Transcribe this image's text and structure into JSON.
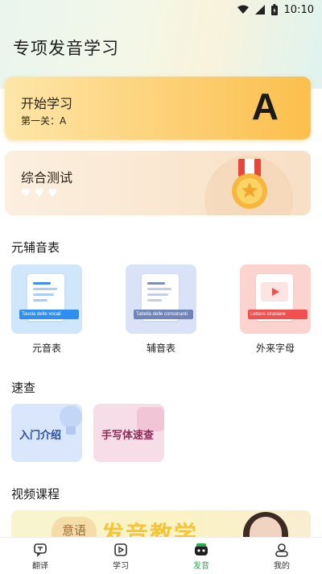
{
  "status": {
    "time": "10:10"
  },
  "header": {
    "title": "专项发音学习"
  },
  "start_card": {
    "title": "开始学习",
    "level": "第一关：A",
    "letter": "A"
  },
  "test_card": {
    "title": "综合测试",
    "hearts": 3
  },
  "sections": {
    "tables": "元辅音表",
    "quick": "速查",
    "video": "视频课程"
  },
  "tables": [
    {
      "label": "元音表",
      "ribbon": "Tavola delle vocali",
      "bg": "#cfe6fb",
      "ribbon_color": "#2f8ff0"
    },
    {
      "label": "辅音表",
      "ribbon": "Tabella delle consonanti",
      "bg": "#d9e2f7",
      "ribbon_color": "#6f84b8"
    },
    {
      "label": "外来字母",
      "ribbon": "Lettere straniere",
      "bg": "#fbd4d0",
      "ribbon_color": "#f05050"
    }
  ],
  "quick": [
    {
      "label": "入门介绍",
      "bg": "#d9e6fb",
      "color": "#2b4f9c"
    },
    {
      "label": "手写体速查",
      "bg": "#f7dde8",
      "color": "#8c2e5a"
    }
  ],
  "video": {
    "tag": "意语",
    "title": "发音教学"
  },
  "tabs": [
    {
      "label": "翻译",
      "active": false
    },
    {
      "label": "学习",
      "active": false
    },
    {
      "label": "发音",
      "active": true
    },
    {
      "label": "我的",
      "active": false
    }
  ],
  "colors": {
    "accent": "#2fa84f"
  }
}
